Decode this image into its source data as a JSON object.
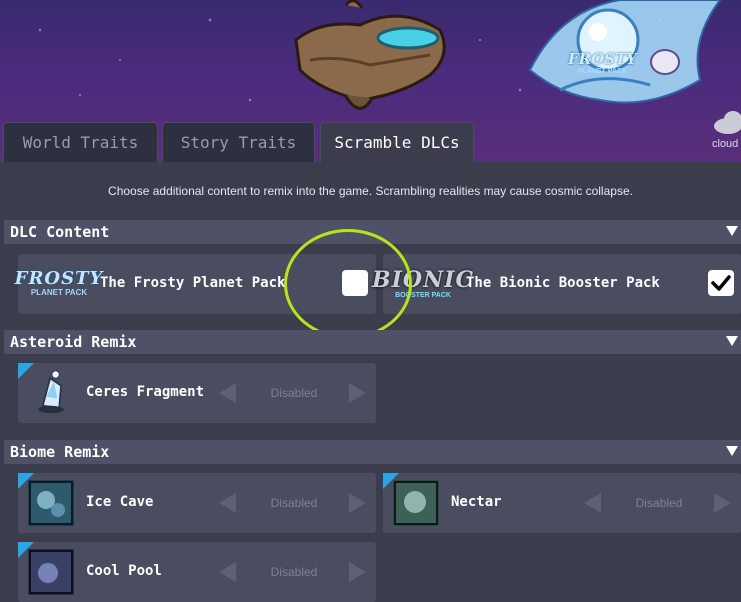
{
  "banner": {
    "frosty_badge_line1": "FROSTY",
    "frosty_badge_line2": "PLANET PACK",
    "cloud_label": "cloud"
  },
  "tabs": [
    {
      "label": "World Traits",
      "active": false
    },
    {
      "label": "Story Traits",
      "active": false
    },
    {
      "label": "Scramble DLCs",
      "active": true
    }
  ],
  "subtitle": "Choose additional content to remix into the game. Scrambling realities may cause cosmic collapse.",
  "dlc_content": {
    "title": "DLC Content",
    "items": [
      {
        "logo_line1": "FROSTY",
        "logo_line2": "PLANET PACK",
        "label": "The Frosty Planet Pack",
        "checked": false
      },
      {
        "logo_line1": "BIONIC",
        "logo_line2": "BOOSTER PACK",
        "label": "The Bionic Booster Pack",
        "checked": true
      }
    ]
  },
  "asteroid_remix": {
    "title": "Asteroid Remix",
    "items": [
      {
        "label": "Ceres Fragment",
        "value": "Disabled"
      }
    ]
  },
  "biome_remix": {
    "title": "Biome Remix",
    "items": [
      {
        "label": "Ice Cave",
        "value": "Disabled"
      },
      {
        "label": "Nectar",
        "value": "Disabled"
      },
      {
        "label": "Cool Pool",
        "value": "Disabled"
      }
    ]
  },
  "colors": {
    "background": "#3b3d4d",
    "section_header": "#4f5266",
    "card": "#4a4d5f",
    "highlight": "#b8e41a",
    "corner_tag": "#2aa6e6"
  }
}
